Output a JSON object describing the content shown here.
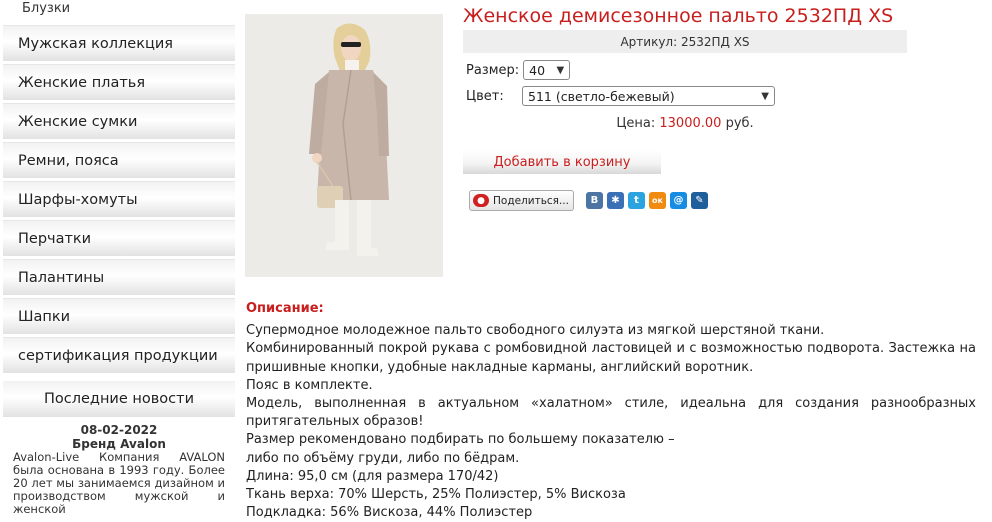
{
  "sidebar": {
    "top_item": "Блузки",
    "items": [
      {
        "label": "Мужская коллекция"
      },
      {
        "label": "Женские платья"
      },
      {
        "label": "Женские сумки"
      },
      {
        "label": "Ремни, пояса"
      },
      {
        "label": "Шарфы-хомуты"
      },
      {
        "label": "Перчатки"
      },
      {
        "label": "Палантины"
      },
      {
        "label": "Шапки"
      },
      {
        "label": "сертификация продукции"
      }
    ],
    "news": {
      "heading": "Последние новости",
      "date": "08-02-2022",
      "title": "Бренд Avalon",
      "body": "Avalon-Live Компания AVALON была основана в 1993 году. Более 20 лет мы занимаемся дизайном и производством мужской и женской"
    }
  },
  "product": {
    "title": "Женское демисезонное пальто 2532ПД XS",
    "sku": "Артикул: 2532ПД XS",
    "size_label": "Размер:",
    "size_value": "40",
    "color_label": "Цвет:",
    "color_value": "511 (светло-бежевый)",
    "price_label": "Цена:",
    "price_value": "13000.00",
    "price_currency": "руб.",
    "add_to_cart": "Добавить в корзину",
    "share_label": "Поделиться..."
  },
  "social_icons": [
    {
      "name": "vk-icon",
      "glyph": "В",
      "color": "#4c75a3"
    },
    {
      "name": "friends-icon",
      "glyph": "✱",
      "color": "#3b6fb6"
    },
    {
      "name": "twitter-icon",
      "glyph": "t",
      "color": "#2aa3e0"
    },
    {
      "name": "odnoklassniki-icon",
      "glyph": "ок",
      "color": "#f08a11"
    },
    {
      "name": "mailru-icon",
      "glyph": "@",
      "color": "#168de2"
    },
    {
      "name": "livejournal-icon",
      "glyph": "✎",
      "color": "#1f5f9c"
    }
  ],
  "description": {
    "label": "Описание:",
    "lines": [
      "Супермодное молодежное пальто свободного силуэта из мягкой шерстяной ткани.",
      "Комбинированный покрой рукава с ромбовидной ластовицей и с возможностью подворота. Застежка на пришивные кнопки, удобные накладные карманы, английский воротник.",
      "Пояс в комплекте.",
      "Модель, выполненная в актуальном «халатном» стиле, идеальна для создания разнообразных притягательных образов!",
      "Размер рекомендовано подбирать по большему показателю –",
      "либо по объёму груди, либо по бёдрам.",
      "Длина: 95,0 см (для размера 170/42)",
      "Ткань верха: 70% Шерсть, 25% Полиэстер, 5% Вискоза",
      "Подкладка: 56% Вискоза, 44% Полиэстер"
    ]
  },
  "colors": {
    "accent": "#c81e1e"
  }
}
